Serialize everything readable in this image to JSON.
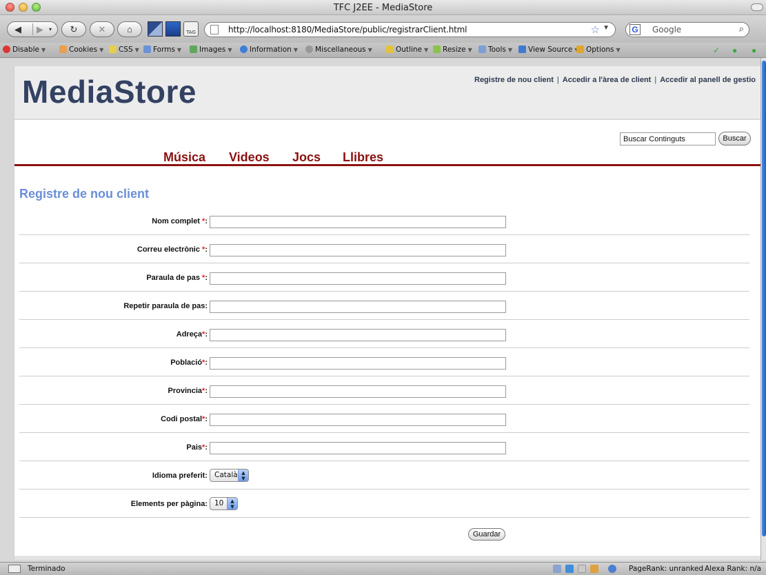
{
  "browser": {
    "window_title": "TFC J2EE - MediaStore",
    "url": "http://localhost:8180/MediaStore/public/registrarClient.html",
    "search_placeholder": "Google",
    "tag_label": "TAG",
    "status_text": "Terminado",
    "pagerank": "PageRank: unranked",
    "alexa": "Alexa Rank: n/a",
    "devtoolbar": [
      "Disable",
      "Cookies",
      "CSS",
      "Forms",
      "Images",
      "Information",
      "Miscellaneous",
      "Outline",
      "Resize",
      "Tools",
      "View Source",
      "Options"
    ]
  },
  "site": {
    "brand": "MediaStore",
    "top_links": [
      "Registre de nou client",
      "Accedir a l'àrea de client",
      "Accedir al panell de gestio"
    ],
    "search_value": "Buscar Continguts",
    "search_button": "Buscar",
    "menu": [
      "Música",
      "Videos",
      "Jocs",
      "Llibres"
    ]
  },
  "form": {
    "title": "Registre de nou client",
    "fields": [
      {
        "label": "Nom complet",
        "required": " *",
        "suffix": ":"
      },
      {
        "label": "Correu electrònic",
        "required": " *",
        "suffix": ":"
      },
      {
        "label": "Paraula de pas",
        "required": " *",
        "suffix": ":"
      },
      {
        "label": "Repetir paraula de pas:",
        "required": "",
        "suffix": ""
      },
      {
        "label": "Adreça",
        "required": "*",
        "suffix": ":"
      },
      {
        "label": "Població",
        "required": "*",
        "suffix": ":"
      },
      {
        "label": "Provincia",
        "required": "*",
        "suffix": ":"
      },
      {
        "label": "Codi postal",
        "required": "*",
        "suffix": ":"
      },
      {
        "label": "Pais",
        "required": "*",
        "suffix": ":"
      }
    ],
    "language_label": "Idioma preferit:",
    "language_value": "Català",
    "per_page_label": "Elements per pàgina:",
    "per_page_value": "10",
    "save_button": "Guardar"
  }
}
